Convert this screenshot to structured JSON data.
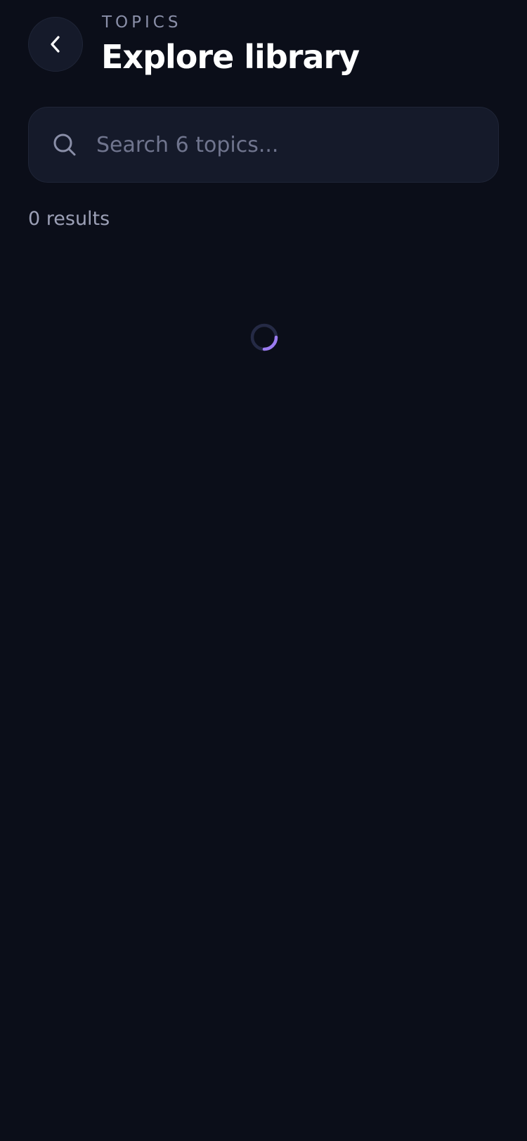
{
  "header": {
    "eyebrow": "TOPICS",
    "title": "Explore library",
    "back_icon": "chevron-left-icon"
  },
  "search": {
    "placeholder": "Search 6 topics...",
    "value": "",
    "icon": "search-icon"
  },
  "results": {
    "label": "0 results"
  },
  "loading": {
    "icon": "spinner-icon"
  },
  "colors": {
    "background": "#0b0e19",
    "surface": "#151a2a",
    "border": "#1f2537",
    "accent": "#9b7bf0",
    "muted_text": "#9ca0b6"
  }
}
